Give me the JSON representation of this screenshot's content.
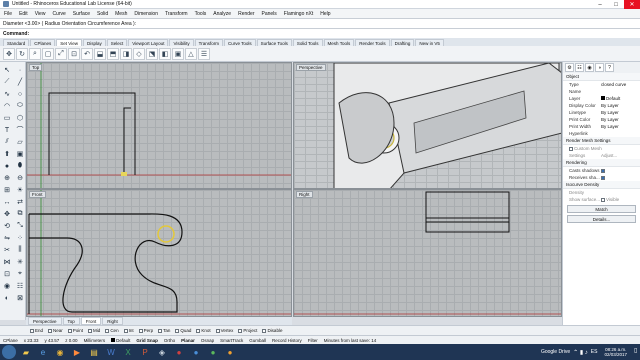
{
  "window": {
    "title": "Untitled - Rhinoceros Educational Lab License (64-bit)"
  },
  "menu": [
    "File",
    "Edit",
    "View",
    "Curve",
    "Surface",
    "Solid",
    "Mesh",
    "Dimension",
    "Transform",
    "Tools",
    "Analyze",
    "Render",
    "Panels",
    "Flamingo nXt",
    "Help"
  ],
  "command": {
    "history": "Diameter <3.00> ( Radius  Orientation  Circumference  Area ):",
    "prompt": "Command:"
  },
  "tabs": [
    "Standard",
    "CPlanes",
    "Set View",
    "Display",
    "Select",
    "Viewport Layout",
    "Visibility",
    "Transform",
    "Curve Tools",
    "Surface Tools",
    "Solid Tools",
    "Mesh Tools",
    "Render Tools",
    "Drafting",
    "New in V5"
  ],
  "active_tab": "Set View",
  "viewports": {
    "top": "Top",
    "perspective": "Perspective",
    "front": "Front",
    "right": "Right"
  },
  "viewport_tabs": [
    "Perspective",
    "Top",
    "Front",
    "Right"
  ],
  "active_viewport_tab": "Front",
  "osnap": [
    "End",
    "Near",
    "Point",
    "Mid",
    "Cen",
    "Int",
    "Perp",
    "Tan",
    "Quad",
    "Knot",
    "Vertex",
    "Project",
    "Disable"
  ],
  "status": {
    "cplane": "CPlane",
    "x": "x 23.33",
    "y": "y 43.57",
    "z": "z 0.00",
    "units": "Millimeters",
    "layer": "Default",
    "buttons": [
      "Grid Snap",
      "Ortho",
      "Planar",
      "Osnap",
      "SmartTrack",
      "Gumball",
      "Record History",
      "Filter"
    ],
    "message": "Minutes from last save: 14"
  },
  "properties": {
    "section": "Object",
    "rows": [
      {
        "k": "Type",
        "v": "closed curve"
      },
      {
        "k": "Name",
        "v": ""
      },
      {
        "k": "Layer",
        "v": "Default"
      },
      {
        "k": "Display Color",
        "v": "By Layer"
      },
      {
        "k": "Linetype",
        "v": "By Layer"
      },
      {
        "k": "Print Color",
        "v": "By Layer"
      },
      {
        "k": "Print Width",
        "v": "By Layer"
      },
      {
        "k": "Hyperlink",
        "v": ""
      }
    ],
    "render_mesh": "Render Mesh Settings",
    "custom_mesh": "Custom Mesh",
    "settings": "Settings",
    "adjust": "Adjust...",
    "rendering": "Rendering",
    "casts_shadows": "Casts shadows",
    "receives_shadows": "Receives sha...",
    "isocurve": "Isocurve Density",
    "density": "Density",
    "show_surface": "Show surface...",
    "visible": "Visible",
    "match": "Match",
    "details": "Details..."
  },
  "taskbar_time": "08:26 a.m.",
  "taskbar_date": "02/03/2017",
  "taskbar_label": "Google Drive",
  "taskbar_lang": "ES"
}
